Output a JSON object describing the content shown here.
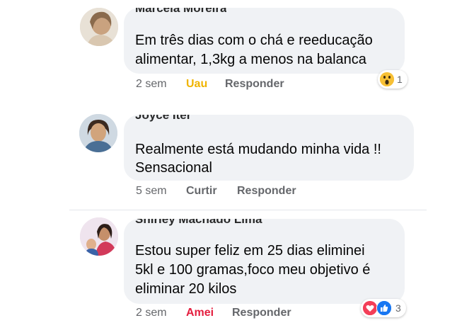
{
  "colors": {
    "reaction_wow": "#f0b400",
    "reaction_love": "#e41e3f",
    "meta_gray": "#65676b",
    "bubble_bg": "#f0f2f5",
    "like_blue": "#1877f2"
  },
  "comments": [
    {
      "author": "Marcela Moreira",
      "text_lines": [
        "Em três dias com o chá e reeducação",
        "alimentar, 1,3kg a menos na balanca"
      ],
      "time": "2 sem",
      "reaction_action": "Uau",
      "reply_label": "Responder",
      "reactions": {
        "icons": [
          "wow-icon"
        ],
        "count": "1"
      }
    },
    {
      "author": "Joyce Iter",
      "text_lines": [
        "Realmente está mudando minha vida !!",
        "Sensacional"
      ],
      "time": "5 sem",
      "reaction_action": "Curtir",
      "reply_label": "Responder"
    },
    {
      "author": "Shirley Machado Lima",
      "text_lines": [
        "Estou super feliz em 25 dias eliminei",
        "5kl e 100 gramas,foco meu objetivo é",
        "eliminar 20 kilos"
      ],
      "time": "2 sem",
      "reaction_action": "Amei",
      "reply_label": "Responder",
      "reactions": {
        "icons": [
          "love-icon",
          "like-icon"
        ],
        "count": "3"
      }
    }
  ]
}
